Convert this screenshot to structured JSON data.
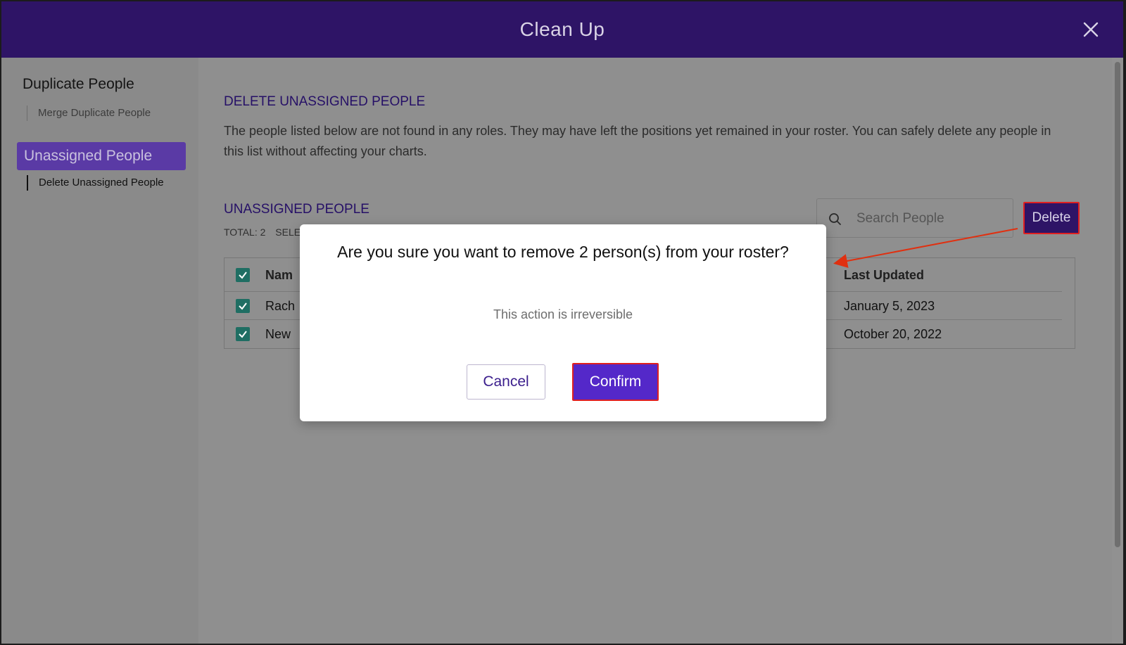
{
  "window": {
    "title": "Clean Up"
  },
  "sidebar": {
    "groups": [
      {
        "title": "Duplicate People",
        "sub": "Merge Duplicate People"
      },
      {
        "title": "Unassigned People",
        "sub": "Delete Unassigned People"
      }
    ]
  },
  "main": {
    "section_title": "DELETE UNASSIGNED PEOPLE",
    "description": "The people listed below are not found in any roles. They may have left the positions yet remained in your roster. You can safely delete any people in this list without affecting your charts.",
    "list_title": "UNASSIGNED PEOPLE",
    "total_label": "TOTAL: 2",
    "selected_label": "SELE",
    "search": {
      "placeholder": "Search People"
    },
    "delete_label": "Delete",
    "table": {
      "columns": [
        "Nam",
        "Last Updated"
      ],
      "rows": [
        {
          "name": "Rach",
          "last_updated": "January 5, 2023"
        },
        {
          "name": "New",
          "last_updated": "October 20, 2022"
        }
      ]
    }
  },
  "modal": {
    "question": "Are you sure you want to remove 2 person(s) from your roster?",
    "note": "This action is irreversible",
    "cancel_label": "Cancel",
    "confirm_label": "Confirm"
  },
  "colors": {
    "header_bg": "#2e1466",
    "accent": "#5428c9",
    "highlight": "#e02020",
    "checkbox": "#1f6e63"
  }
}
